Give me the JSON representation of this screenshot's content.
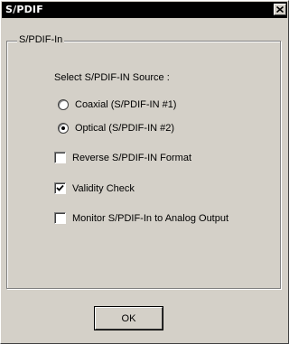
{
  "window": {
    "title": "S/PDIF",
    "close_glyph": "X"
  },
  "group": {
    "title": "S/PDIF-In",
    "source_label": "Select S/PDIF-IN Source :",
    "sources": [
      {
        "label": "Coaxial (S/PDIF-IN #1)",
        "selected": false
      },
      {
        "label": "Optical (S/PDIF-IN #2)",
        "selected": true
      }
    ],
    "options": [
      {
        "label": "Reverse S/PDIF-IN Format",
        "checked": false
      },
      {
        "label": "Validity Check",
        "checked": true
      },
      {
        "label": "Monitor S/PDIF-In to Analog Output",
        "checked": false
      }
    ]
  },
  "buttons": {
    "ok_label": "OK"
  },
  "icons": {
    "close": "close-icon",
    "check": "checkmark-icon"
  },
  "colors": {
    "face": "#d4d0c8",
    "titlebar": "#000000",
    "title_text": "#ffffff"
  }
}
